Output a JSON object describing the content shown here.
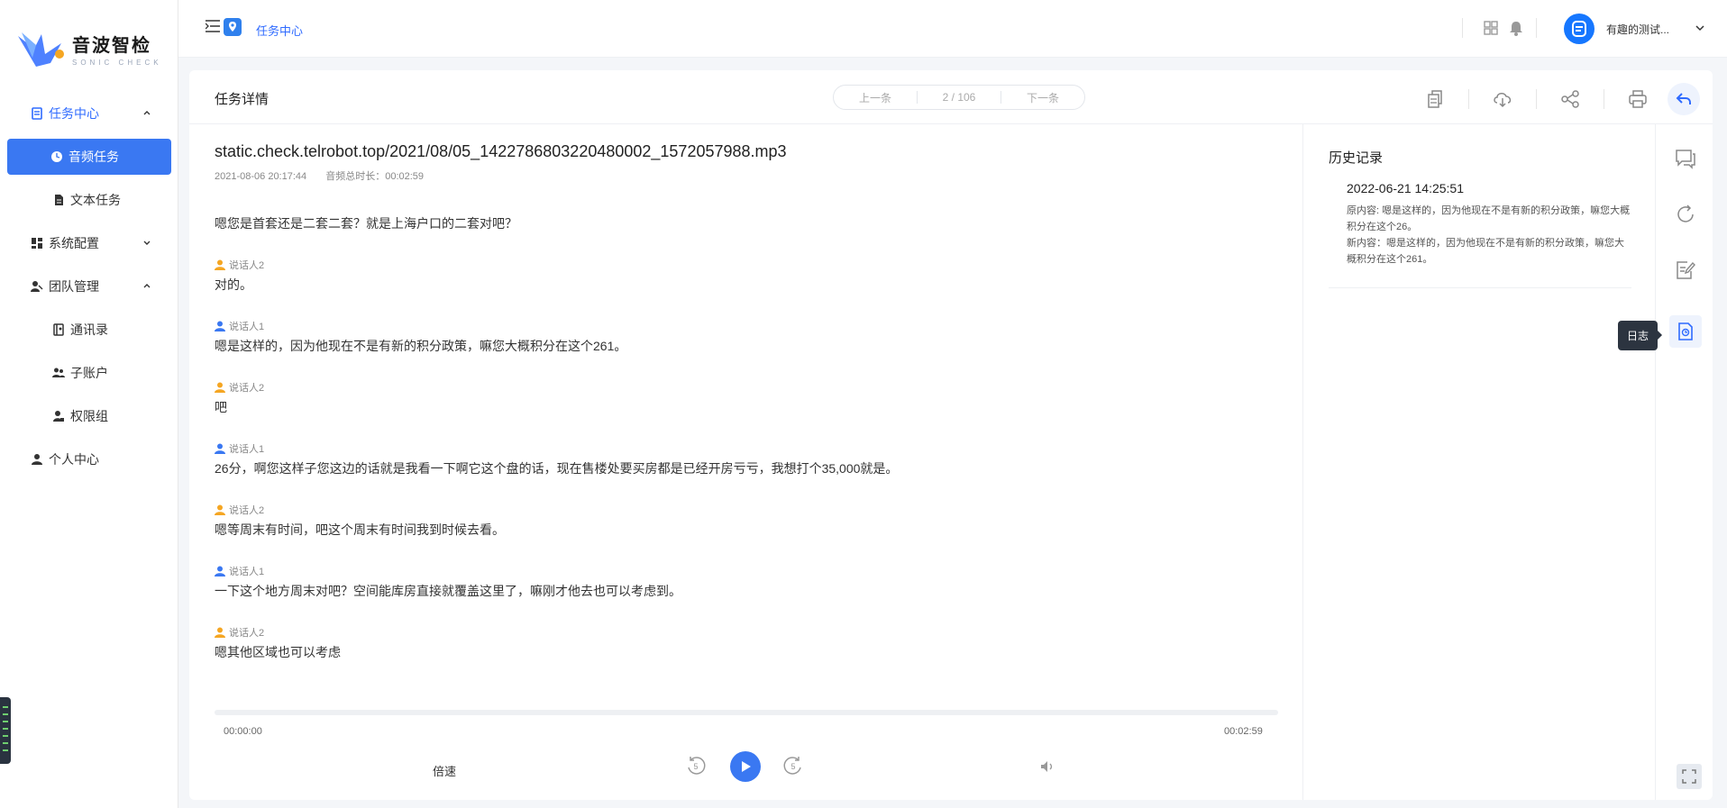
{
  "brand": {
    "name": "音波智检",
    "tagline": "SONIC CHECK"
  },
  "sidebar": {
    "items": [
      {
        "label": "任务中心",
        "state": "expanded"
      },
      {
        "label": "音频任务"
      },
      {
        "label": "文本任务"
      },
      {
        "label": "系统配置",
        "state": "collapsed"
      },
      {
        "label": "团队管理",
        "state": "expanded"
      },
      {
        "label": "通讯录"
      },
      {
        "label": "子账户"
      },
      {
        "label": "权限组"
      },
      {
        "label": "个人中心"
      }
    ]
  },
  "header": {
    "breadcrumb": "任务中心",
    "user_name": "有趣的测试..."
  },
  "task": {
    "title": "任务详情",
    "prev_label": "上一条",
    "pager": "2 / 106",
    "next_label": "下一条",
    "file_name": "static.check.telrobot.top/2021/08/05_1422786803220480002_1572057988.mp3",
    "created": "2021-08-06 20:17:44",
    "duration_label": "音频总时长：00:02:59"
  },
  "transcript": {
    "first_line": "嗯您是首套还是二套二套？就是上海户口的二套对吧？",
    "lines": [
      {
        "speaker": "说话人2",
        "text": "对的。"
      },
      {
        "speaker": "说话人1",
        "text": "嗯是这样的，因为他现在不是有新的积分政策，嘛您大概积分在这个261。"
      },
      {
        "speaker": "说话人2",
        "text": "吧"
      },
      {
        "speaker": "说话人1",
        "text": "26分，啊您这样子您这边的话就是我看一下啊它这个盘的话，现在售楼处要买房都是已经开房亏亏，我想打个35,000就是。"
      },
      {
        "speaker": "说话人2",
        "text": "嗯等周末有时间，吧这个周末有时间我到时候去看。"
      },
      {
        "speaker": "说话人1",
        "text": "一下这个地方周末对吧？空间能库房直接就覆盖这里了，嘛刚才他去也可以考虑到。"
      },
      {
        "speaker": "说话人2",
        "text": "嗯其他区域也可以考虑"
      }
    ]
  },
  "player": {
    "current": "00:00:00",
    "total": "00:02:59",
    "progress": 0,
    "speed_label": "倍速",
    "skip_seconds": "5"
  },
  "history": {
    "title": "历史记录",
    "entries": [
      {
        "time": "2022-06-21 14:25:51",
        "old": "原内容: 嗯是这样的，因为他现在不是有新的积分政策，嘛您大概积分在这个26。",
        "new": "新内容：嗯是这样的，因为他现在不是有新的积分政策，嘛您大概积分在这个261。"
      }
    ]
  },
  "rail": {
    "tooltip": "日志"
  },
  "colors": {
    "accent": "#3a78f2",
    "speaker1": "#3a78f2",
    "speaker2": "#f5a623"
  }
}
